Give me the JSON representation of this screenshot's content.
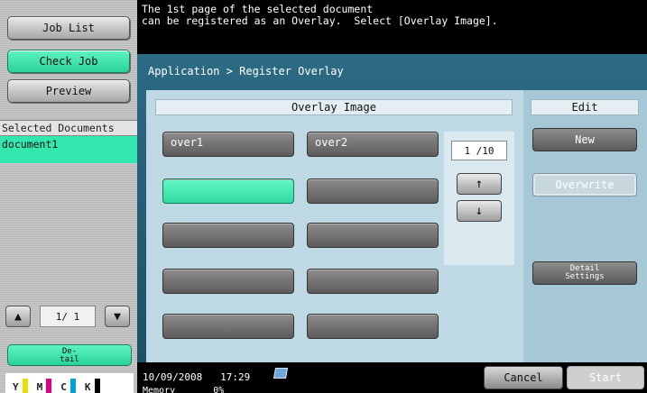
{
  "sidebar": {
    "job_list": "Job List",
    "check_job": "Check Job",
    "preview": "Preview",
    "selected_documents_header": "Selected Documents",
    "selected_document": "document1",
    "page_indicator": "1/ 1",
    "detail_label_1": "De-",
    "detail_label_2": "tail",
    "toner": [
      "Y",
      "M",
      "C",
      "K"
    ],
    "toner_colors": [
      "#e8e000",
      "#e0007a",
      "#00a3d6",
      "#000000"
    ]
  },
  "message": "The 1st page of the selected document\ncan be registered as an Overlay.  Select [Overlay Image].",
  "breadcrumb": "Application > Register Overlay",
  "overlay": {
    "header": "Overlay Image",
    "items": [
      "over1",
      "over2",
      "",
      "",
      "",
      "",
      "",
      "",
      "",
      ""
    ],
    "page_indicator": "1  /10",
    "up_arrow": "↑",
    "down_arrow": "↓"
  },
  "edit": {
    "header": "Edit",
    "new": "New",
    "overwrite": "Overwrite",
    "detail_1": "Detail",
    "detail_2": "Settings"
  },
  "status": {
    "date": "10/09/2008",
    "time": "17:29",
    "memory_label": "Memory",
    "memory_value": "0%",
    "cancel": "Cancel",
    "start": "Start"
  },
  "colors": {
    "accent_green": "#34e7ae",
    "panel_blue": "#2c6b84"
  }
}
